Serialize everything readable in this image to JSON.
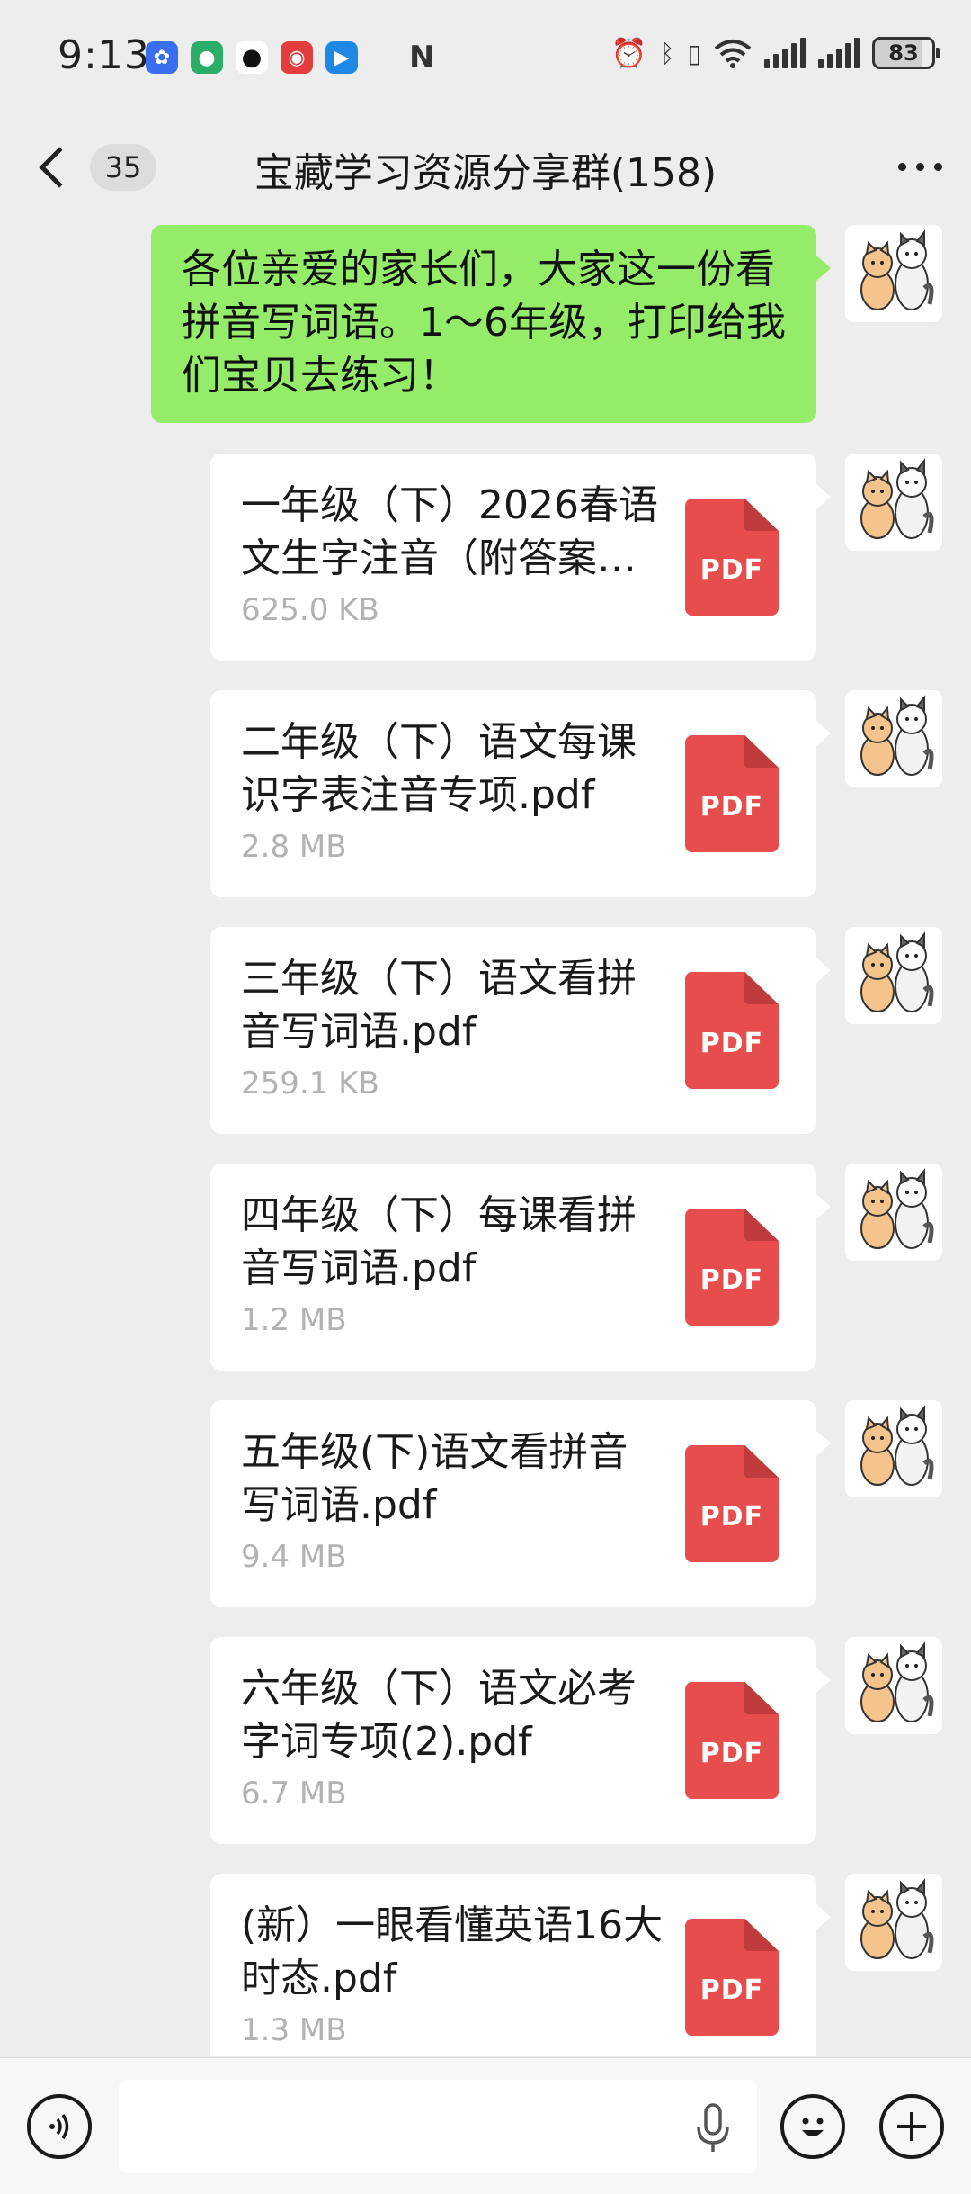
{
  "status_bar": {
    "time": "9:13",
    "notification_icons": [
      "tencent-app-icon",
      "wechat-icon",
      "qq-icon",
      "weibo-icon",
      "tencent-docs-icon"
    ],
    "nfc_icon": "nfc-icon",
    "system_icons": [
      "alarm-icon",
      "bluetooth-icon",
      "vibrate-icon",
      "wifi-icon",
      "signal-icon",
      "signal-icon"
    ],
    "battery_level": "83"
  },
  "nav": {
    "back_icon": "chevron-left-icon",
    "unread_count": "35",
    "title": "宝藏学习资源分享群(158)",
    "more_icon": "more-icon"
  },
  "messages": {
    "text_message": "各位亲爱的家长们，大家这一份看拼音写词语。1～6年级，打印给我们宝贝去练习！",
    "files": [
      {
        "name": "一年级（下）2026春语文生字注音（附答案…",
        "size": "625.0 KB",
        "type": "PDF"
      },
      {
        "name": "二年级（下）语文每课识字表注音专项.pdf",
        "size": "2.8 MB",
        "type": "PDF"
      },
      {
        "name": "三年级（下）语文看拼音写词语.pdf",
        "size": "259.1 KB",
        "type": "PDF"
      },
      {
        "name": "四年级（下）每课看拼音写词语.pdf",
        "size": "1.2 MB",
        "type": "PDF"
      },
      {
        "name": "五年级(下)语文看拼音写词语.pdf",
        "size": "9.4 MB",
        "type": "PDF"
      },
      {
        "name": "六年级（下）语文必考字词专项(2).pdf",
        "size": "6.7 MB",
        "type": "PDF"
      },
      {
        "name": "(新）一眼看懂英语16大时态.pdf",
        "size": "1.3 MB",
        "type": "PDF"
      }
    ]
  },
  "input_bar": {
    "voice_icon": "voice-icon",
    "input_value": "",
    "mic_icon": "mic-icon",
    "emoji_icon": "emoji-icon",
    "plus_icon": "plus-icon"
  },
  "colors": {
    "background": "#ededed",
    "sent_bubble": "#95ec69",
    "pdf_red": "#e64d4c",
    "file_size_gray": "#b2b2b2"
  }
}
